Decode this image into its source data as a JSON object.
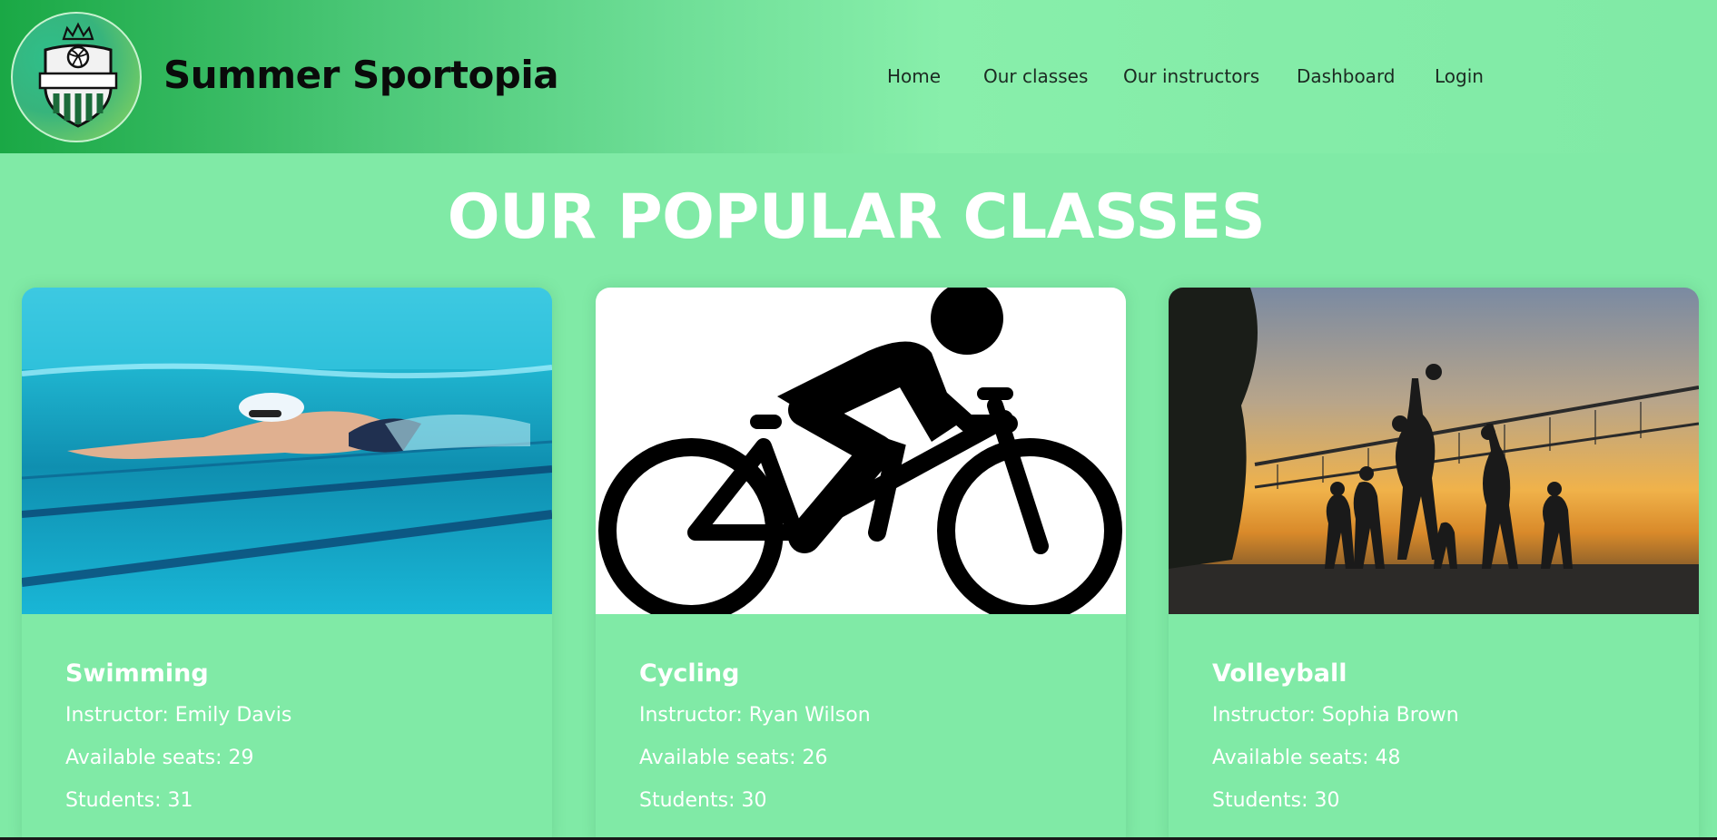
{
  "brand": {
    "name": "Summer Sportopia",
    "logo_text": "SUMMER SPORTOPIA"
  },
  "nav": {
    "items": [
      {
        "label": "Home"
      },
      {
        "label": "Our classes"
      },
      {
        "label": "Our instructors"
      },
      {
        "label": "Dashboard"
      },
      {
        "label": "Login"
      }
    ]
  },
  "section": {
    "title": "OUR POPULAR CLASSES"
  },
  "classes": [
    {
      "name": "Swimming",
      "instructor": "Instructor: Emily Davis",
      "seats": "Available seats: 29",
      "students": "Students: 31",
      "image": "swimmer-photo"
    },
    {
      "name": "Cycling",
      "instructor": "Instructor: Ryan Wilson",
      "seats": "Available seats: 26",
      "students": "Students: 30",
      "image": "cyclist-pictogram"
    },
    {
      "name": "Volleyball",
      "instructor": "Instructor: Sophia Brown",
      "seats": "Available seats: 48",
      "students": "Students: 30",
      "image": "volleyball-sunset-photo"
    }
  ],
  "colors": {
    "page_bg": "#80eaa6",
    "nav_dark": "#1aa845",
    "text_white": "#ffffff",
    "brand_text": "#0a0a0a"
  }
}
